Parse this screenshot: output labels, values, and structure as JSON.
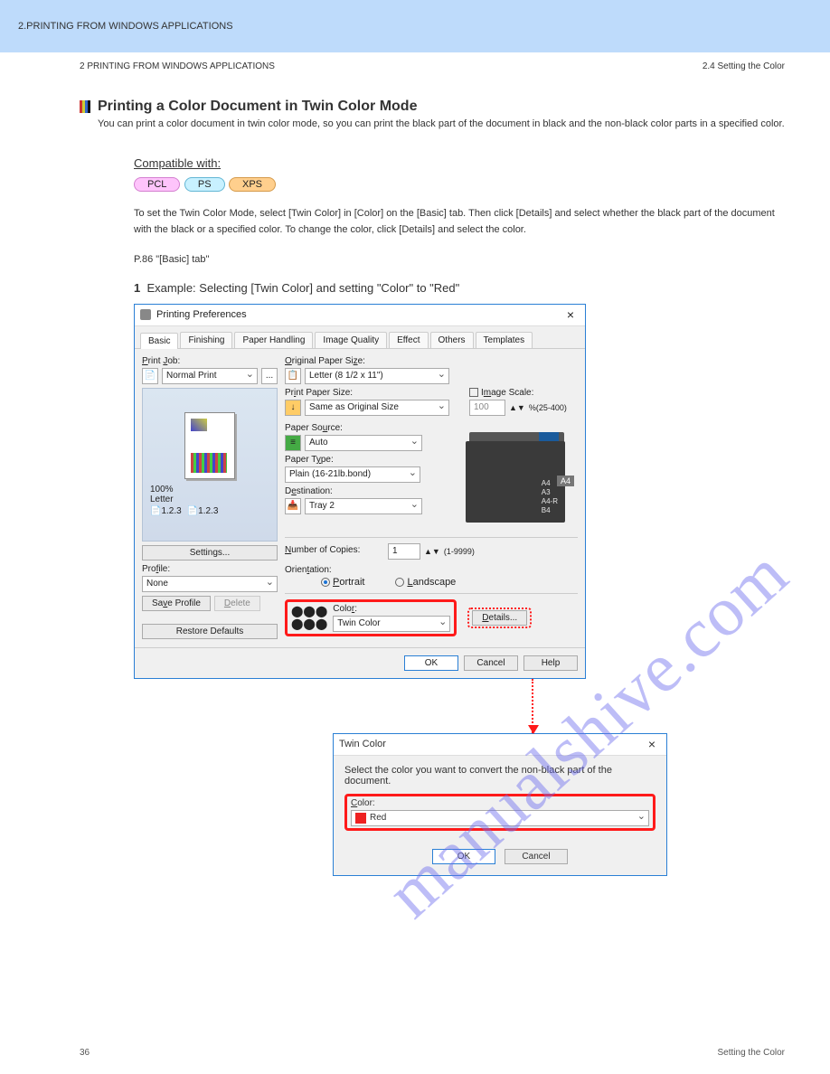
{
  "topbar": {
    "chapter": "2.PRINTING FROM WINDOWS APPLICATIONS"
  },
  "header": {
    "left": "2 PRINTING FROM WINDOWS APPLICATIONS",
    "right": "2.4 Setting the Color"
  },
  "section": {
    "title": "Printing a Color Document in Twin Color Mode",
    "subtitle": "You can print a color document in twin color mode, so you can print the black part of the document in black and the non-black color parts in a specified color."
  },
  "pills": {
    "label": "Compatible with:",
    "pink": "PCL",
    "blue": "PS",
    "orange": "XPS"
  },
  "bodytext1": "To set the Twin Color Mode, select [Twin Color] in [Color] on the [Basic] tab. Then click [Details] and select whether the black part of the document with the black or a specified color. To change the color, click [Details] and select the color.",
  "bodytext2": "P.86 \"[Basic] tab\"",
  "step": "Example: Selecting [Twin Color] and setting \"Color\" to \"Red\"",
  "dialog": {
    "title": "Printing Preferences",
    "tabs": [
      "Basic",
      "Finishing",
      "Paper Handling",
      "Image Quality",
      "Effect",
      "Others",
      "Templates"
    ],
    "printjob_label": "Print Job:",
    "printjob_value": "Normal Print",
    "preview_zoom": "100%",
    "preview_size": "Letter",
    "preview_pages": "1.2.3",
    "settings_btn": "Settings...",
    "profile_label": "Profile:",
    "profile_value": "None",
    "save_profile": "Save Profile",
    "delete_btn": "Delete",
    "restore_btn": "Restore Defaults",
    "orig_paper_label": "Original Paper Size:",
    "orig_paper_value": "Letter (8 1/2 x 11\")",
    "print_paper_label": "Print Paper Size:",
    "print_paper_value": "Same as Original Size",
    "image_scale_label": "Image Scale:",
    "image_scale_value": "100",
    "image_scale_range": "%(25-400)",
    "paper_source_label": "Paper Source:",
    "paper_source_value": "Auto",
    "paper_type_label": "Paper Type:",
    "paper_type_value": "Plain (16-21lb.bond)",
    "destination_label": "Destination:",
    "destination_value": "Tray 2",
    "copies_label": "Number of Copies:",
    "copies_value": "1",
    "copies_range": "(1-9999)",
    "orientation_label": "Orientation:",
    "portrait": "Portrait",
    "landscape": "Landscape",
    "color_label": "Color:",
    "color_value": "Twin Color",
    "details_btn": "Details...",
    "ok": "OK",
    "cancel": "Cancel",
    "help": "Help",
    "trays": {
      "a4": "A4",
      "a3": "A3",
      "a4r": "A4-R",
      "b4": "B4",
      "big": "A4"
    }
  },
  "twin": {
    "title": "Twin Color",
    "instruction": "Select the color you want to convert the non-black part of the document.",
    "color_label": "Color:",
    "color_value": "Red",
    "ok": "OK",
    "cancel": "Cancel"
  },
  "footer": {
    "page": "36",
    "doc": "Setting the Color"
  },
  "watermark": "manualshive.com"
}
